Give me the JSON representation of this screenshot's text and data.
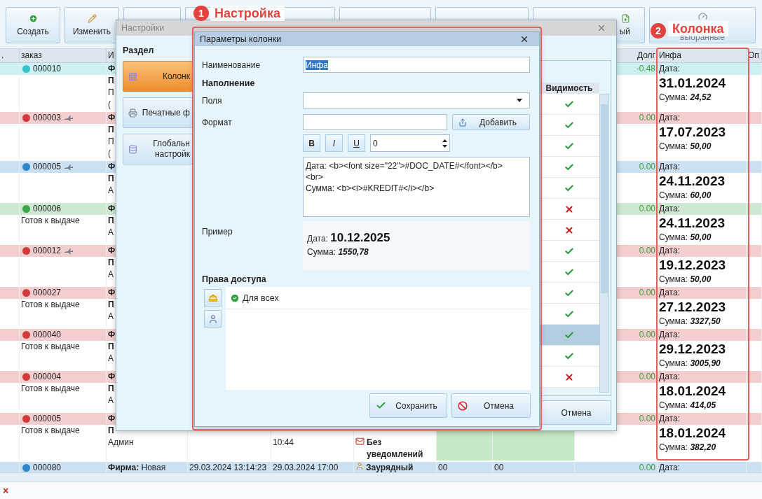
{
  "toolbar": {
    "buttons": [
      {
        "label": "Создать"
      },
      {
        "label": "Изменить"
      },
      {
        "label": "ый"
      },
      {
        "label": "выбранные"
      }
    ]
  },
  "annotations": [
    {
      "number": "1",
      "label": "Настройка"
    },
    {
      "number": "2",
      "label": "Колонка"
    }
  ],
  "table": {
    "headings": {
      "dot": ".",
      "order": "заказ",
      "column_3": "И",
      "debt": "Долг",
      "info": "Инфа",
      "column_11": "Оп"
    },
    "rows": [
      {
        "id": "000010",
        "color": "#36c3c9",
        "airplane_icon": false,
        "column_3": [
          {
            "text": "Ф",
            "bold": true
          },
          {
            "text": "П",
            "bold": true
          },
          {
            "text": "П",
            "bold": false
          },
          {
            "text": "(",
            "bold": false
          }
        ],
        "debt": "-0.48",
        "info": {
          "date_label": "Дата:",
          "date": "31.01.2024",
          "sum_label": "Сумма:",
          "sum": "24,52"
        }
      },
      {
        "id": "000003",
        "color": "#d03a3a",
        "airplane_icon": true,
        "column_3": [
          {
            "text": "Ф",
            "bold": true
          },
          {
            "text": "П",
            "bold": true
          },
          {
            "text": "П",
            "bold": false
          },
          {
            "text": "(",
            "bold": false
          }
        ],
        "debt": "0.00",
        "info": {
          "date_label": "Дата:",
          "date": "17.07.2023",
          "sum_label": "Сумма:",
          "sum": "50,00"
        }
      },
      {
        "id": "000005",
        "color": "#2f86c9",
        "airplane_icon": true,
        "column_3": [
          {
            "text": "Ф",
            "bold": true
          },
          {
            "text": "П",
            "bold": true
          },
          {
            "text": "А",
            "bold": false
          }
        ],
        "debt": "0.00",
        "info": {
          "date_label": "Дата:",
          "date": "24.11.2023",
          "sum_label": "Сумма:",
          "sum": "60,00"
        }
      },
      {
        "id": "000006",
        "color": "#3aa54a",
        "airplane_icon": false,
        "status": "Готов к выдаче",
        "column_3": [
          {
            "text": "Ф",
            "bold": true
          },
          {
            "text": "П",
            "bold": true
          },
          {
            "text": "А",
            "bold": false
          }
        ],
        "debt": "0.00",
        "info": {
          "date_label": "Дата:",
          "date": "24.11.2023",
          "sum_label": "Сумма:",
          "sum": "50,00"
        }
      },
      {
        "id": "000012",
        "color": "#d03a3a",
        "airplane_icon": true,
        "column_3": [
          {
            "text": "Ф",
            "bold": true
          },
          {
            "text": "П",
            "bold": true
          },
          {
            "text": "А",
            "bold": false
          }
        ],
        "debt": "0.00",
        "info": {
          "date_label": "Дата:",
          "date": "19.12.2023",
          "sum_label": "Сумма:",
          "sum": "50,00"
        }
      },
      {
        "id": "000027",
        "color": "#d03a3a",
        "airplane_icon": false,
        "status": "Готов к выдаче",
        "column_3": [
          {
            "text": "Ф",
            "bold": true
          },
          {
            "text": "П",
            "bold": true
          },
          {
            "text": "А",
            "bold": false
          }
        ],
        "debt": "0.00",
        "info": {
          "date_label": "Дата:",
          "date": "27.12.2023",
          "sum_label": "Сумма:",
          "sum": "3327,50"
        }
      },
      {
        "id": "000040",
        "color": "#d03a3a",
        "airplane_icon": false,
        "status": "Готов к выдаче",
        "column_3": [
          {
            "text": "Ф",
            "bold": true
          },
          {
            "text": "П",
            "bold": true
          },
          {
            "text": "А",
            "bold": false
          }
        ],
        "debt": "0.00",
        "info": {
          "date_label": "Дата:",
          "date": "29.12.2023",
          "sum_label": "Сумма:",
          "sum": "3005,90"
        }
      },
      {
        "id": "000004",
        "color": "#d03a3a",
        "airplane_icon": false,
        "status": "Готов к выдаче",
        "column_3": [
          {
            "text": "Ф",
            "bold": true
          },
          {
            "text": "П",
            "bold": true
          },
          {
            "text": "А",
            "bold": false
          }
        ],
        "debt": "0.00",
        "info": {
          "date_label": "Дата:",
          "date": "18.01.2024",
          "sum_label": "Сумма:",
          "sum": "414,05"
        }
      },
      {
        "id": "000005",
        "color": "#d03a3a",
        "airplane_icon": false,
        "status": "Готов к выдаче",
        "column_3": [
          {
            "text": "Ф",
            "bold": true
          },
          {
            "text": "П",
            "bold": true
          },
          {
            "text": "Админ",
            "bold": false
          }
        ],
        "column_5": {
          "text": "10:44",
          "lowered": true
        },
        "column_6": {
          "text": "Без уведомлений",
          "kind": "mail",
          "lowered": true
        },
        "column_7": {
          "highlighted": true
        },
        "column_8": {
          "highlighted": true
        },
        "debt": "0.00",
        "info": {
          "date_label": "Дата:",
          "date": "18.01.2024",
          "sum_label": "Сумма:",
          "sum": "382,20"
        }
      },
      {
        "id": "000080",
        "color": "#2f86c9",
        "airplane_icon": false,
        "column_3": [
          {
            "text": "**Фирма:** Новая",
            "bold": false
          }
        ],
        "column_4": {
          "text": "29.03.2024 13:14:23"
        },
        "column_5": {
          "text": "29.03.2024 17:00"
        },
        "column_6": {
          "text": "Заурядный",
          "kind": "person"
        },
        "column_7": {
          "text": "00"
        },
        "column_8": {
          "text": "00"
        },
        "debt": "0.00",
        "info": {
          "date_label": "Дата:"
        }
      }
    ]
  },
  "settings_dialog": {
    "title": "Настройки",
    "section_label": "Раздел",
    "sections": [
      {
        "label": "Колонк",
        "selected": true
      },
      {
        "label": "Печатные ф",
        "selected": false
      },
      {
        "label": "Глобальн\nнастройк",
        "selected": false
      }
    ],
    "visibility_header": "Видимость",
    "visibility": [
      {
        "visible": true,
        "selected": false
      },
      {
        "visible": true,
        "selected": false
      },
      {
        "visible": true,
        "selected": false
      },
      {
        "visible": true,
        "selected": false
      },
      {
        "visible": true,
        "selected": false
      },
      {
        "visible": false,
        "selected": false
      },
      {
        "visible": false,
        "selected": false
      },
      {
        "visible": true,
        "selected": false
      },
      {
        "visible": true,
        "selected": false
      },
      {
        "visible": true,
        "selected": false
      },
      {
        "visible": true,
        "selected": false
      },
      {
        "visible": true,
        "selected": true
      },
      {
        "visible": true,
        "selected": false
      },
      {
        "visible": false,
        "selected": false
      }
    ],
    "cancel_button": "Отмена"
  },
  "params_dialog": {
    "title": "Параметры колонки",
    "name_label": "Наименование",
    "name_value": "Инфа",
    "name_selected": true,
    "fill_heading": "Наполнение",
    "fields_label": "Поля",
    "format_label": "Формат",
    "add_button": "Добавить",
    "format_buttons": [
      {
        "label": "B",
        "kind": "bold"
      },
      {
        "label": "I",
        "kind": "italic"
      },
      {
        "label": "U",
        "kind": "underline"
      }
    ],
    "size_value": "0",
    "template": "Дата: <b><font size=\"22\">#DOC_DATE#</font></b>\n<br>\nСумма: <b><i>#KREDIT#</i></b>",
    "example_label": "Пример",
    "example": {
      "date_label": "Дата:",
      "date": "10.12.2025",
      "sum_label": "Сумма:",
      "sum": "1550,78"
    },
    "access_heading": "Права доступа",
    "access_items": [
      {
        "label": "Для всех",
        "checked": true
      }
    ],
    "buttons": [
      {
        "label": "Сохранить",
        "kind": "save"
      },
      {
        "label": "Отмена",
        "kind": "cancel"
      }
    ]
  },
  "status_bar": {
    "close_mark": "×"
  }
}
